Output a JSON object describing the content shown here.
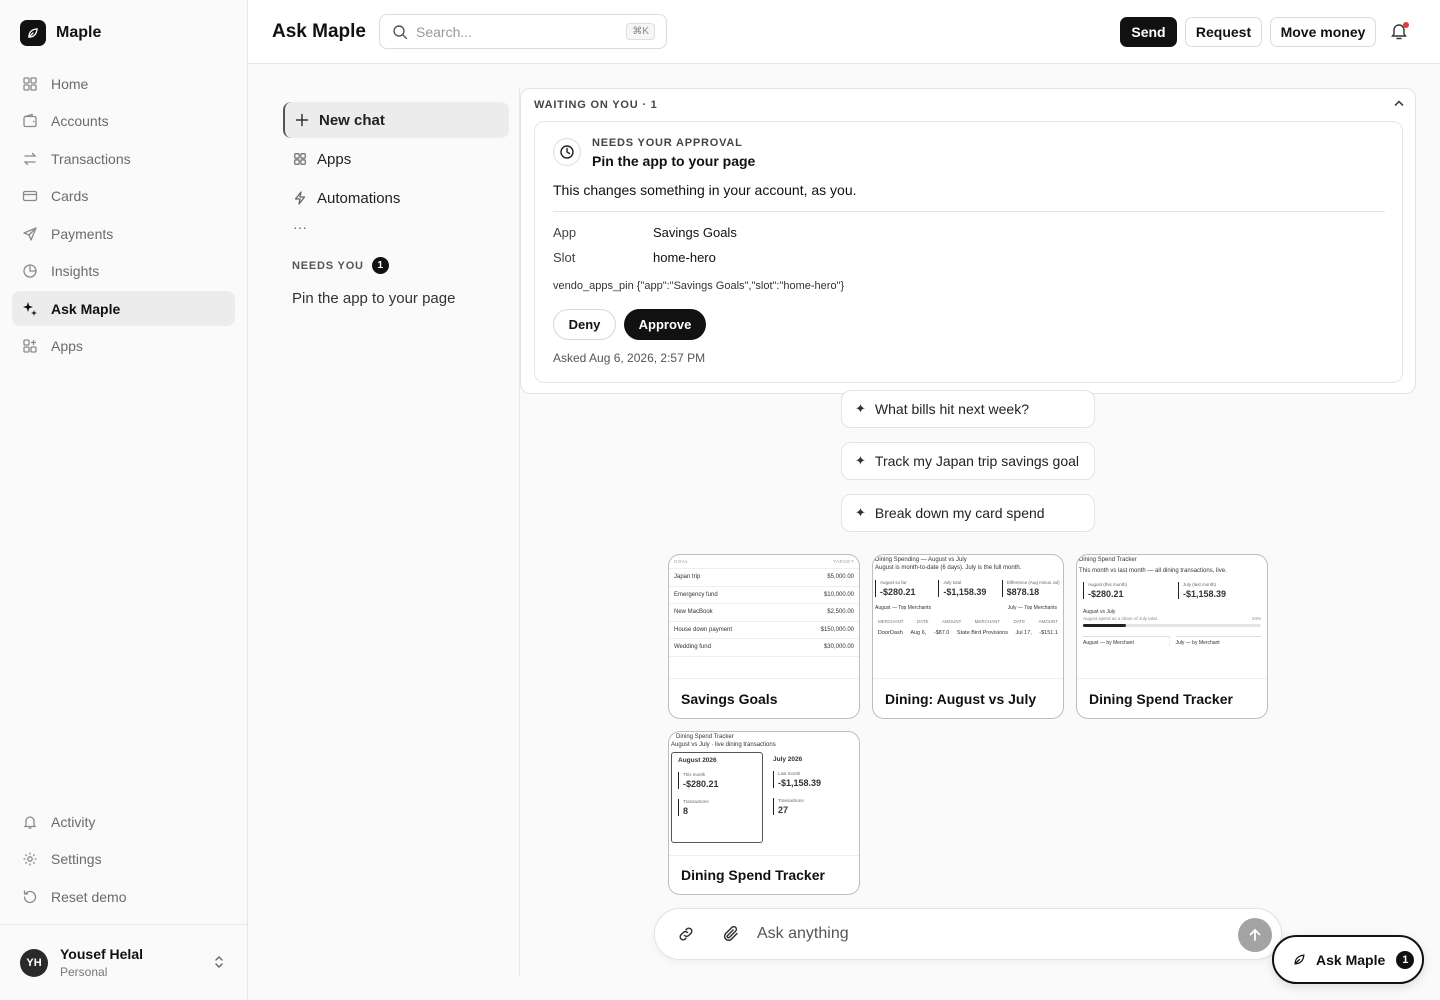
{
  "app": {
    "name": "Maple"
  },
  "sidebar": {
    "items": [
      {
        "label": "Home",
        "icon": "grid-icon"
      },
      {
        "label": "Accounts",
        "icon": "wallet-icon"
      },
      {
        "label": "Transactions",
        "icon": "arrows-icon"
      },
      {
        "label": "Cards",
        "icon": "card-icon"
      },
      {
        "label": "Payments",
        "icon": "send-icon"
      },
      {
        "label": "Insights",
        "icon": "pie-icon"
      },
      {
        "label": "Ask Maple",
        "icon": "sparkles-icon",
        "active": true
      },
      {
        "label": "Apps",
        "icon": "apps-icon"
      }
    ],
    "bottom": [
      {
        "label": "Activity",
        "icon": "bell-icon"
      },
      {
        "label": "Settings",
        "icon": "gear-icon"
      },
      {
        "label": "Reset demo",
        "icon": "reset-icon"
      }
    ],
    "user": {
      "initials": "YH",
      "name": "Yousef Helal",
      "type": "Personal"
    }
  },
  "header": {
    "title": "Ask Maple",
    "search_placeholder": "Search...",
    "search_shortcut": "⌘K",
    "send_label": "Send",
    "request_label": "Request",
    "move_money_label": "Move money"
  },
  "chat_sidebar": {
    "new_chat": "New chat",
    "apps": "Apps",
    "automations": "Automations",
    "more": "···",
    "needs_you_label": "NEEDS YOU",
    "needs_you_count": "1",
    "needs_you_item": "Pin the app to your page"
  },
  "waiting": {
    "label": "WAITING ON YOU · 1",
    "approval": {
      "eyebrow": "NEEDS YOUR APPROVAL",
      "title": "Pin the app to your page",
      "description": "This changes something in your account, as you.",
      "app_key": "App",
      "app_value": "Savings Goals",
      "slot_key": "Slot",
      "slot_value": "home-hero",
      "code": "vendo_apps_pin {\"app\":\"Savings Goals\",\"slot\":\"home-hero\"}",
      "deny_label": "Deny",
      "approve_label": "Approve",
      "asked": "Asked Aug 6, 2026, 2:57 PM"
    }
  },
  "suggestions": [
    "What bills hit next week?",
    "Track my Japan trip savings goal",
    "Break down my card spend"
  ],
  "cards": {
    "savings": {
      "label": "Savings Goals",
      "col_goal": "GOAL",
      "col_target": "TARGET",
      "rows": [
        {
          "goal": "Japan trip",
          "target": "$5,000.00"
        },
        {
          "goal": "Emergency fund",
          "target": "$10,000.00"
        },
        {
          "goal": "New MacBook",
          "target": "$2,500.00"
        },
        {
          "goal": "House down payment",
          "target": "$150,000.00"
        },
        {
          "goal": "Wedding fund",
          "target": "$30,000.00"
        }
      ]
    },
    "dining_aug_july": {
      "label": "Dining: August vs July",
      "title": "Dining Spending — August vs July",
      "subtitle": "August is month-to-date (6 days). July is the full month.",
      "stat1_label": "August so far",
      "stat1_value": "-$280.21",
      "stat2_label": "July total",
      "stat2_value": "-$1,158.39",
      "stat3_label": "Difference (Aug minus Jul)",
      "stat3_value": "$878.18",
      "aug_merchants": "August — Top Merchants",
      "jul_merchants": "July — Top Merchants",
      "col_merchant": "MERCHANT",
      "col_date": "DATE",
      "col_amount": "AMOUNT",
      "row1_merchant": "DoorDash",
      "row1_date": "Aug 6,",
      "row1_amount": "-$87.0",
      "row2_merchant": "State Bird Provisions",
      "row2_date": "Jul 17,",
      "row2_amount": "-$151.1"
    },
    "dining_tracker_1": {
      "label": "Dining Spend Tracker",
      "title": "Dining Spend Tracker",
      "subtitle": "This month vs last month — all dining transactions, live.",
      "stat1_label": "August (this month)",
      "stat1_value": "-$280.21",
      "stat2_label": "July (last month)",
      "stat2_value": "-$1,158.39",
      "bar_title": "August vs July",
      "bar_sub": "August spend as a share of July total",
      "bar_pct": "24%",
      "bar_fraction": 0.24,
      "aug_by": "August — by Merchant",
      "jul_by": "July — by Merchant"
    },
    "dining_tracker_2": {
      "label": "Dining Spend Tracker",
      "title": "Dining Spend Tracker",
      "subtitle": "August vs July · live dining transactions",
      "aug_header": "August 2026",
      "jul_header": "July 2026",
      "aug_this_month_label": "This month",
      "aug_this_month": "-$280.21",
      "jul_last_month_label": "Last month",
      "jul_last_month": "-$1,158.39",
      "tx_label": "Transactions",
      "aug_tx": "8",
      "jul_tx": "27"
    }
  },
  "composer": {
    "placeholder": "Ask anything"
  },
  "fab": {
    "label": "Ask Maple",
    "count": "1"
  }
}
